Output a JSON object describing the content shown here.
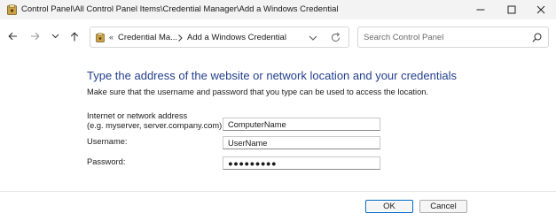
{
  "window": {
    "title": "Control Panel\\All Control Panel Items\\Credential Manager\\Add a Windows Credential"
  },
  "address_bar": {
    "overflow_chevron": "«",
    "segment1": "Credential Ma...",
    "segment2": "Add a Windows Credential"
  },
  "search": {
    "placeholder": "Search Control Panel"
  },
  "main": {
    "heading": "Type the address of the website or network location and your credentials",
    "subtext": "Make sure that the username and password that you type can be used to access the location.",
    "address_label_line1": "Internet or network address",
    "address_label_line2": "(e.g. myserver, server.company.com):",
    "address_value": "ComputerName",
    "username_label": "Username:",
    "username_value": "UserName",
    "password_label": "Password:",
    "password_value": "●●●●●●●●●"
  },
  "footer": {
    "ok_label": "OK",
    "cancel_label": "Cancel"
  },
  "icons": {
    "app": "credential-manager-icon",
    "minimize": "minimize-icon",
    "maximize": "maximize-icon",
    "close": "close-icon",
    "back": "back-arrow-icon",
    "forward": "forward-arrow-icon",
    "recent": "chevron-down-icon",
    "up": "up-arrow-icon",
    "folder": "control-panel-icon",
    "breadcrumb_separator": "chevron-right-icon",
    "address_dropdown": "chevron-down-icon",
    "refresh": "refresh-icon",
    "search": "search-icon"
  },
  "colors": {
    "heading": "#24408e",
    "titlebar_bg": "#f3f3f3",
    "default_button_border": "#0067c0"
  }
}
